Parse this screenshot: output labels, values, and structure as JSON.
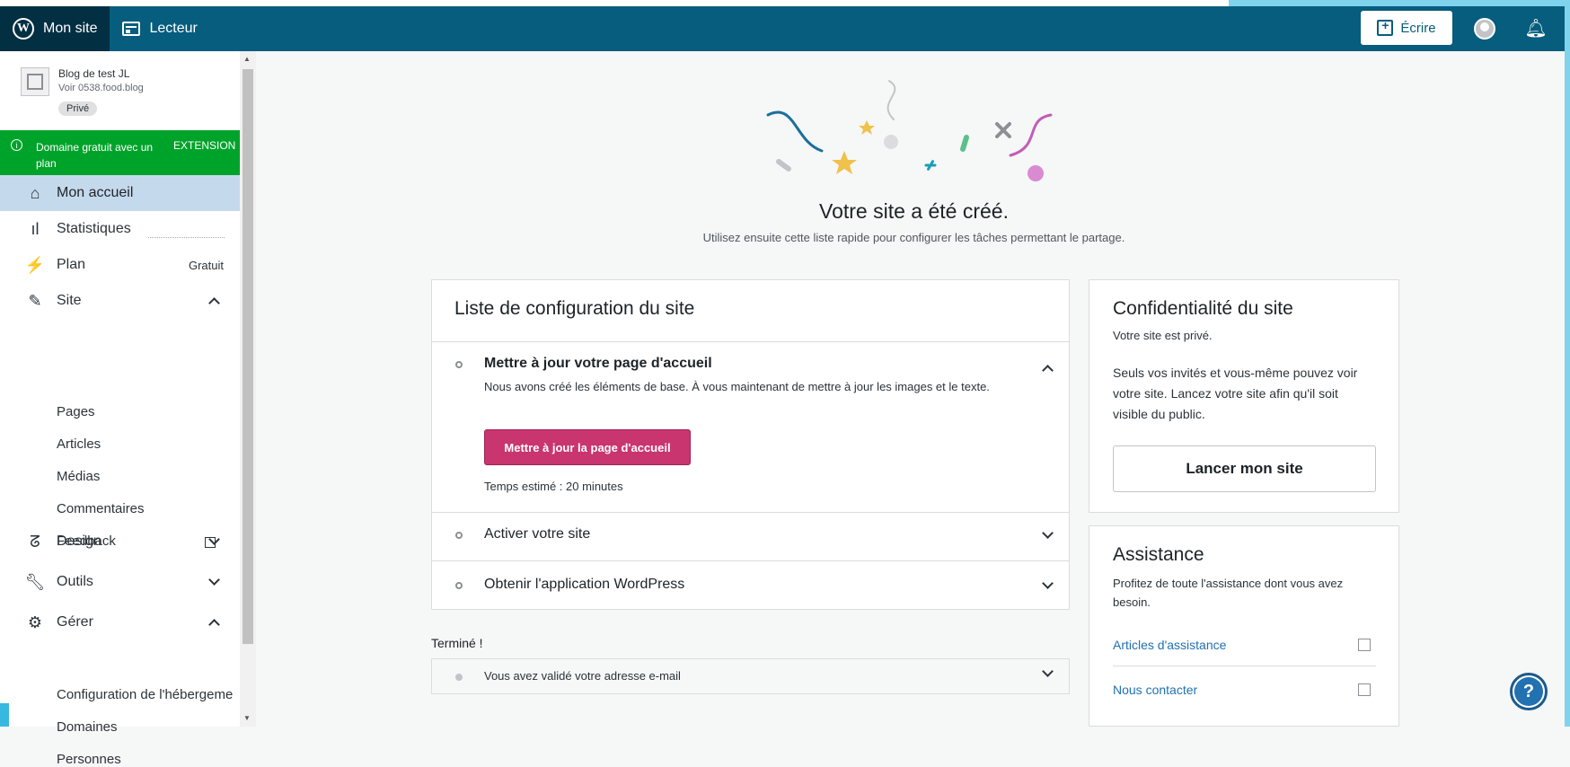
{
  "masterbar": {
    "my_site": "Mon site",
    "reader": "Lecteur",
    "write": "Écrire"
  },
  "site": {
    "title": "Blog de test JL",
    "url": "Voir 0538.food.blog",
    "badge": "Privé"
  },
  "promo": {
    "text": "Domaine gratuit avec un plan",
    "badge": "EXTENSION"
  },
  "nav": {
    "home": "Mon accueil",
    "stats": "Statistiques",
    "plan": "Plan",
    "plan_badge": "Gratuit",
    "site": "Site",
    "site_items": [
      "Pages",
      "Articles",
      "Médias",
      "Commentaires",
      "Feedback"
    ],
    "design": "Design",
    "tools": "Outils",
    "manage": "Gérer",
    "manage_items": [
      "Configuration de l'hébergeme",
      "Domaines",
      "Personnes"
    ]
  },
  "hero": {
    "title": "Votre site a été créé.",
    "subtitle": "Utilisez ensuite cette liste rapide pour configurer les tâches permettant le partage."
  },
  "checklist": {
    "title": "Liste de configuration du site",
    "tasks": [
      {
        "title": "Mettre à jour votre page d'accueil",
        "description": "Nous avons créé les éléments de base. À vous maintenant de mettre à jour les images et le texte.",
        "button": "Mettre à jour la page d'accueil",
        "time": "Temps estimé : 20 minutes"
      },
      {
        "title": "Activer votre site"
      },
      {
        "title": "Obtenir l'application WordPress"
      }
    ],
    "done_label": "Terminé !",
    "done_items": [
      "Vous avez validé votre adresse e-mail"
    ]
  },
  "privacy": {
    "title": "Confidentialité du site",
    "subtitle": "Votre site est privé.",
    "body": "Seuls vos invités et vous-même pouvez voir votre site. Lancez votre site afin qu'il soit visible du public.",
    "button": "Lancer mon site"
  },
  "help": {
    "title": "Assistance",
    "body": "Profitez de toute l'assistance dont vous avez besoin.",
    "links": [
      "Articles d'assistance",
      "Nous contacter"
    ]
  },
  "colors": {
    "masterbar": "#065d7d",
    "promo": "#00a32a",
    "primary_button": "#c9356e",
    "link": "#2271b1"
  }
}
